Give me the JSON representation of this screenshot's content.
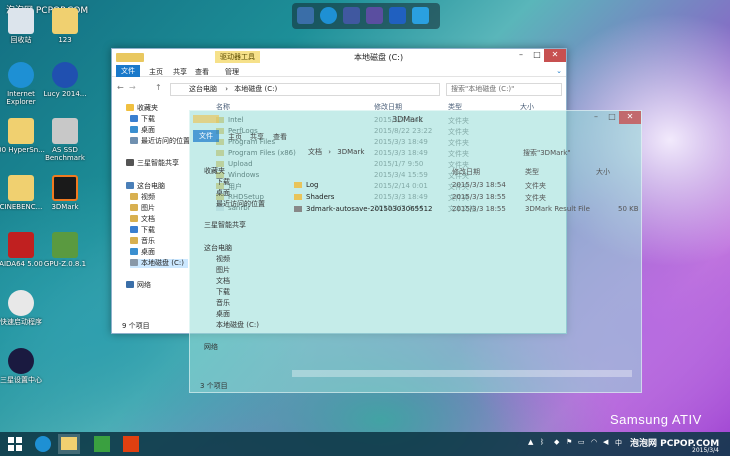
{
  "watermark": {
    "text": "泡泡网 PCPOP.COM",
    "text_bottom": "泡泡网 PCPOP.COM"
  },
  "brand": {
    "text": "Samsung ATIV"
  },
  "desktop_icons": [
    {
      "label": "回收站"
    },
    {
      "label": "123"
    },
    {
      "label": "Internet Explorer"
    },
    {
      "label": "Lucy 2014..."
    },
    {
      "label": "00 HyperSn..."
    },
    {
      "label": "AS SSD Benchmark"
    },
    {
      "label": "CINEBENC..."
    },
    {
      "label": "3DMark"
    },
    {
      "label": "AIDA64 5.00"
    },
    {
      "label": "GPU-Z.0.8.1"
    },
    {
      "label": "快速启动程序"
    },
    {
      "label": "三星设置中心"
    }
  ],
  "window_main": {
    "title": "本地磁盘 (C:)",
    "tools_tab": "驱动器工具",
    "menu": [
      "文件",
      "主页",
      "共享",
      "查看",
      "管理"
    ],
    "address": [
      "这台电脑",
      "本地磁盘 (C:)"
    ],
    "search_placeholder": "搜索\"本地磁盘 (C:)\"",
    "columns": [
      "名称",
      "修改日期",
      "类型",
      "大小"
    ],
    "files": [
      {
        "name": "Intel",
        "date": "2015/1/7 9:41",
        "type": "文件夹"
      },
      {
        "name": "PerfLogs",
        "date": "2015/8/22 23:22",
        "type": "文件夹"
      },
      {
        "name": "Program Files",
        "date": "2015/3/3 18:49",
        "type": "文件夹"
      },
      {
        "name": "Program Files (x86)",
        "date": "2015/3/3 18:49",
        "type": "文件夹"
      },
      {
        "name": "Upload",
        "date": "2015/1/7 9:50",
        "type": "文件夹"
      },
      {
        "name": "Windows",
        "date": "2015/3/4 15:59",
        "type": "文件夹"
      },
      {
        "name": "用户",
        "date": "2015/2/14 0:01",
        "type": "文件夹"
      },
      {
        "name": "RHDSetup",
        "date": "2015/3/3 18:49",
        "type": "文件夹"
      },
      {
        "name": "sanrbi",
        "date": "2015/1/7 9:44",
        "type": "文本文档"
      }
    ],
    "nav": [
      "收藏夹",
      "下载",
      "桌面",
      "最近访问的位置",
      "三星智能共享",
      "这台电脑",
      "视频",
      "图片",
      "文档",
      "下载",
      "音乐",
      "桌面",
      "本地磁盘 (C:)",
      "网络"
    ],
    "status": "9 个项目"
  },
  "window_3d": {
    "address": [
      "文档",
      "3DMark"
    ],
    "title": "3DMark",
    "search_placeholder": "搜索\"3DMark\"",
    "menu": [
      "文件",
      "主页",
      "共享",
      "查看"
    ],
    "columns": [
      "名称",
      "修改日期",
      "类型",
      "大小"
    ],
    "files": [
      {
        "name": "Log",
        "date": "2015/3/3 18:54",
        "type": "文件夹",
        "size": ""
      },
      {
        "name": "Shaders",
        "date": "2015/3/3 18:55",
        "type": "文件夹",
        "size": ""
      },
      {
        "name": "3dmark-autosave-20150303065512",
        "date": "2015/3/3 18:55",
        "type": "3DMark Result File",
        "size": "50 KB"
      }
    ],
    "nav": [
      "收藏夹",
      "下载",
      "桌面",
      "最近访问的位置",
      "三星智能共享",
      "这台电脑",
      "视频",
      "图片",
      "文档",
      "下载",
      "音乐",
      "桌面",
      "本地磁盘 (C:)",
      "网络"
    ],
    "status": "3 个项目"
  },
  "taskbar": {
    "lang": "中",
    "date": "2015/3/4",
    "colors": {
      "bar": "#0c3746"
    }
  }
}
